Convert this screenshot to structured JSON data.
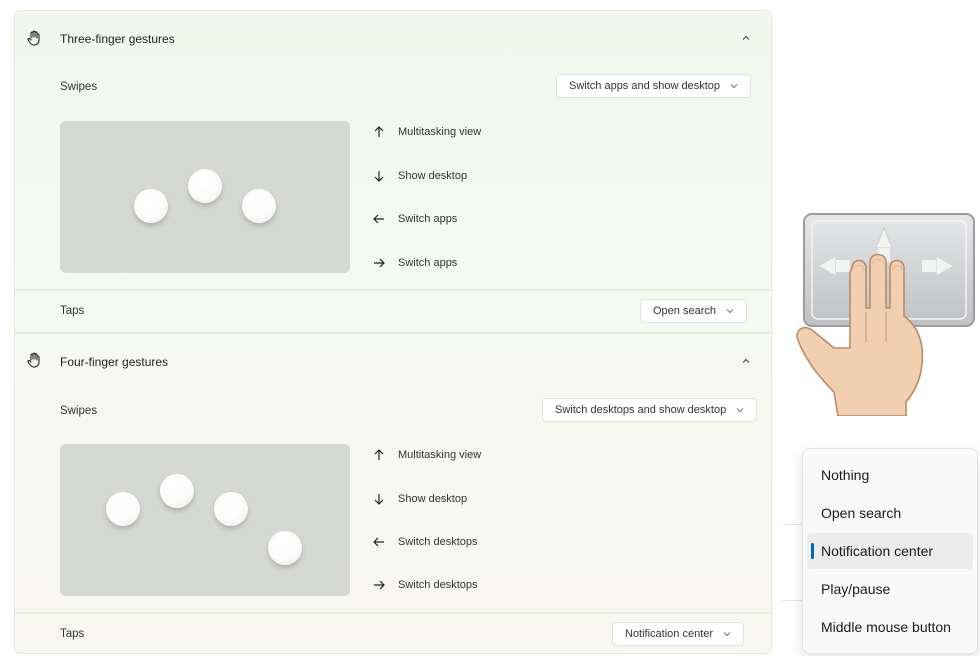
{
  "three_finger": {
    "title": "Three-finger gestures",
    "swipes_label": "Swipes",
    "swipes_value": "Switch apps and show desktop",
    "gestures": [
      "Multitasking view",
      "Show desktop",
      "Switch apps",
      "Switch apps"
    ],
    "taps_label": "Taps",
    "taps_value": "Open search"
  },
  "four_finger": {
    "title": "Four-finger gestures",
    "swipes_label": "Swipes",
    "swipes_value": "Switch desktops and show desktop",
    "gestures": [
      "Multitasking view",
      "Show desktop",
      "Switch desktops",
      "Switch desktops"
    ],
    "taps_label": "Taps",
    "taps_value": "Notification center"
  },
  "taps_menu": {
    "options": [
      "Nothing",
      "Open search",
      "Notification center",
      "Play/pause",
      "Middle mouse button"
    ],
    "selected": "Notification center"
  },
  "icons": {
    "section": "hand-icon",
    "collapse": "chevron-up-icon",
    "dropdown": "chevron-down-icon",
    "gesture_arrows": [
      "arrow-up-icon",
      "arrow-down-icon",
      "arrow-left-icon",
      "arrow-right-icon"
    ]
  },
  "colors": {
    "accent": "#0067c0",
    "panel_bg": "#f3f8ee",
    "preview_bg": "#d6d8d3"
  }
}
